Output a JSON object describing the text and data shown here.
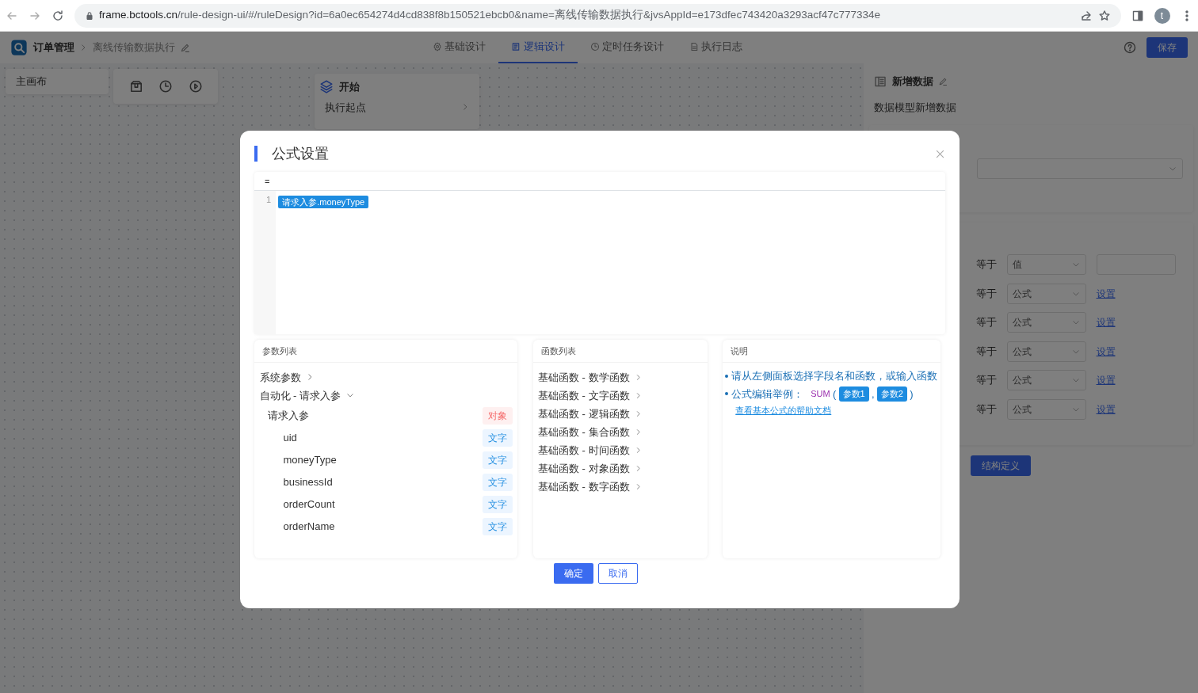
{
  "browser": {
    "host": "frame.bctools.cn",
    "path": "/rule-design-ui/#/ruleDesign?id=6a0ec654274d4cd838f8b150521ebcb0&name=离线传输数据执行&jvsAppId=e173dfec743420a3293acf47c777334e",
    "avatar": "t"
  },
  "app": {
    "breadcrumb": [
      "订单管理",
      "离线传输数据执行"
    ],
    "tabs": [
      {
        "label": "基础设计",
        "selected": false,
        "kind": "gear"
      },
      {
        "label": "逻辑设计",
        "selected": true,
        "kind": "doc"
      },
      {
        "label": "定时任务设计",
        "selected": false,
        "kind": "clock"
      },
      {
        "label": "执行日志",
        "selected": false,
        "kind": "file"
      }
    ],
    "save": "保存"
  },
  "canvas": {
    "sidebar_item": "主画布",
    "start_node": {
      "title": "开始",
      "item": "执行起点"
    }
  },
  "right_panel": {
    "title": "新增数据",
    "subtitle": "数据模型新增数据",
    "rows": [
      {
        "kind": "value",
        "op": "等于",
        "mode": "值"
      },
      {
        "kind": "formula",
        "op": "等于",
        "mode": "公式",
        "link": "设置"
      },
      {
        "kind": "formula",
        "op": "等于",
        "mode": "公式",
        "link": "设置"
      },
      {
        "kind": "formula",
        "op": "等于",
        "mode": "公式",
        "link": "设置"
      },
      {
        "kind": "formula",
        "op": "等于",
        "mode": "公式",
        "link": "设置"
      },
      {
        "kind": "formula",
        "op": "等于",
        "mode": "公式",
        "link": "设置"
      }
    ],
    "button": "结构定义"
  },
  "dialog": {
    "title": "公式设置",
    "editor": {
      "prefix": "=",
      "line_number": "1",
      "token": "请求入参.moneyType"
    },
    "params": {
      "title": "参数列表",
      "groups": [
        {
          "label": "系统参数",
          "expanded": false
        },
        {
          "label": "自动化 - 请求入参",
          "expanded": true,
          "children": [
            {
              "label": "请求入参",
              "type": "对象",
              "kind": "object",
              "children": [
                {
                  "label": "uid",
                  "type": "文字",
                  "kind": "text"
                },
                {
                  "label": "moneyType",
                  "type": "文字",
                  "kind": "text"
                },
                {
                  "label": "businessId",
                  "type": "文字",
                  "kind": "text"
                },
                {
                  "label": "orderCount",
                  "type": "文字",
                  "kind": "text"
                },
                {
                  "label": "orderName",
                  "type": "文字",
                  "kind": "text"
                }
              ]
            }
          ]
        }
      ]
    },
    "functions": {
      "title": "函数列表",
      "items": [
        "基础函数 - 数学函数",
        "基础函数 - 文字函数",
        "基础函数 - 逻辑函数",
        "基础函数 - 集合函数",
        "基础函数 - 时间函数",
        "基础函数 - 对象函数",
        "基础函数 - 数字函数"
      ]
    },
    "help": {
      "title": "说明",
      "tip": "请从左侧面板选择字段名和函数，或输入函数",
      "example_label": "公式编辑举例：",
      "example_fn": "SUM",
      "open": "(",
      "args": [
        "参数1",
        "参数2"
      ],
      "sep": ",",
      "close": ")",
      "link": "查看基本公式的帮助文档"
    },
    "buttons": {
      "ok": "确定",
      "cancel": "取消"
    }
  }
}
